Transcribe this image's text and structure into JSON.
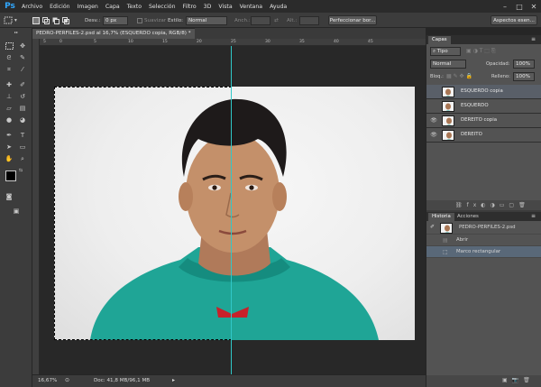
{
  "app": {
    "logo": "Ps"
  },
  "menu": [
    "Archivo",
    "Edición",
    "Imagen",
    "Capa",
    "Texto",
    "Selección",
    "Filtro",
    "3D",
    "Vista",
    "Ventana",
    "Ayuda"
  ],
  "window_controls": [
    "–",
    "□",
    "✕"
  ],
  "options": {
    "feather_label": "Desv.:",
    "feather_value": "0 px",
    "antialias_label": "Suavizar",
    "style_label": "Estilo:",
    "style_value": "Normal",
    "width_label": "Anch.:",
    "height_label": "Alt.:",
    "refine_button": "Perfeccionar bor...",
    "workspace_button": "Aspectos esen..."
  },
  "document": {
    "tab_title": "PEDRO-PERFILES-2.psd al 16,7% (ESQUERDO copia, RGB/8) *",
    "ruler_ticks": [
      "5",
      "0",
      "5",
      "10",
      "15",
      "20",
      "25",
      "30",
      "35",
      "40",
      "45"
    ],
    "zoom": "16,67%",
    "doc_info": "Doc: 41,8 MB/96,1 MB"
  },
  "layers_panel": {
    "tabs": [
      "Capas"
    ],
    "filter_kind": "Tipo",
    "blend_mode": "Normal",
    "opacity_label": "Opacidad:",
    "opacity_value": "100%",
    "lock_label": "Bloq.:",
    "fill_label": "Relleno:",
    "fill_value": "100%",
    "layers": [
      {
        "name": "ESQUERDO copia",
        "visible": false,
        "selected": true
      },
      {
        "name": "ESQUERDO",
        "visible": false,
        "selected": false
      },
      {
        "name": "DEREITO copia",
        "visible": true,
        "selected": false
      },
      {
        "name": "DEREITO",
        "visible": true,
        "selected": false
      }
    ]
  },
  "history_panel": {
    "tabs": [
      "Historia",
      "Acciones"
    ],
    "snapshot": "PEDRO-PERFILES-2.psd",
    "items": [
      {
        "label": "Abrir",
        "selected": false
      },
      {
        "label": "Marco rectangular",
        "selected": true
      }
    ]
  },
  "colors": {
    "accent_guide": "#30c8c8",
    "hoodie": "#1fa596",
    "selection_row": "#596878"
  }
}
